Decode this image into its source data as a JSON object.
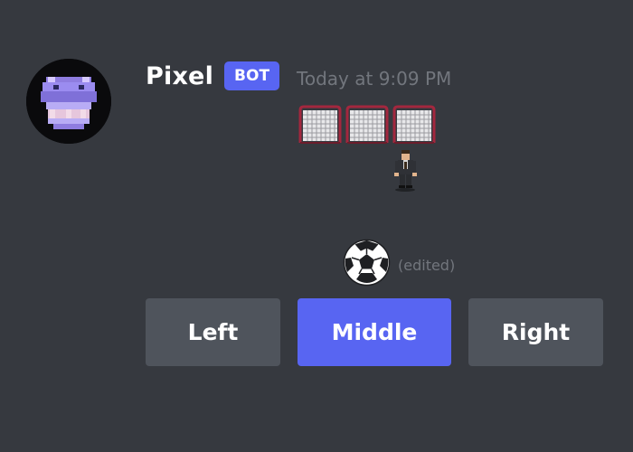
{
  "message": {
    "author": "Pixel",
    "bot_tag": "BOT",
    "timestamp": "Today at 9:09 PM",
    "edited_label": "(edited)"
  },
  "game": {
    "goals": [
      "goal-net-icon",
      "goal-net-icon",
      "goal-net-icon"
    ],
    "goalkeeper_icon": "goalkeeper-icon",
    "ball_icon": "soccer-ball-icon"
  },
  "buttons": {
    "left": "Left",
    "middle": "Middle",
    "right": "Right"
  },
  "colors": {
    "background": "#36393f",
    "blurple": "#5865f2",
    "secondary_button": "#4f545c",
    "muted_text": "#72767d",
    "goal_frame": "#a3273e"
  }
}
